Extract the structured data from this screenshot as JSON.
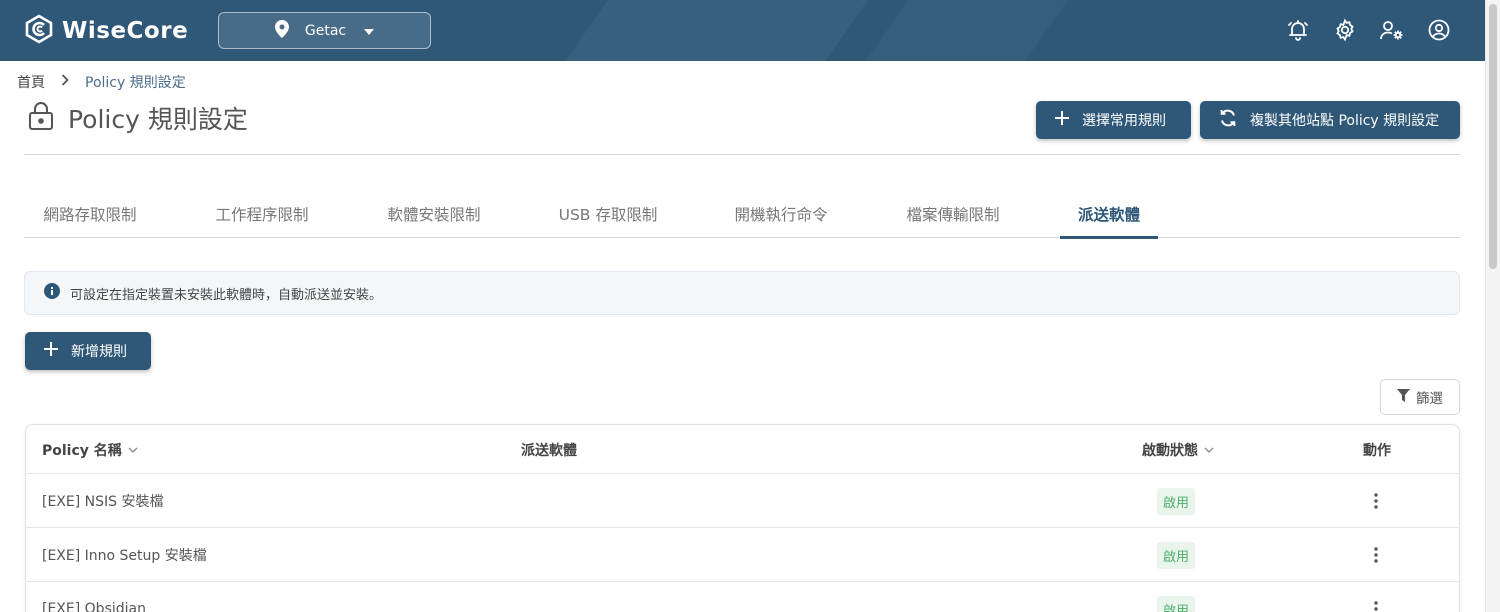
{
  "app": {
    "name": "WiseCore"
  },
  "site_selector": {
    "value": "Getac"
  },
  "breadcrumb": {
    "home": "首頁",
    "current": "Policy 規則設定"
  },
  "page": {
    "title": "Policy 規則設定"
  },
  "actions": {
    "choose_common": "選擇常用規則",
    "copy_other_site": "複製其他站點 Policy 規則設定",
    "add_rule": "新增規則",
    "filter": "篩選"
  },
  "tabs": [
    {
      "label": "網路存取限制"
    },
    {
      "label": "工作程序限制"
    },
    {
      "label": "軟體安裝限制"
    },
    {
      "label": "USB 存取限制"
    },
    {
      "label": "開機執行命令"
    },
    {
      "label": "檔案傳輸限制"
    },
    {
      "label": "派送軟體",
      "active": true
    }
  ],
  "info": {
    "text": "可設定在指定裝置未安裝此軟體時，自動派送並安裝。"
  },
  "table": {
    "columns": [
      "Policy 名稱",
      "派送軟體",
      "啟動狀態",
      "動作"
    ],
    "rows": [
      {
        "name": "[EXE] NSIS 安裝檔",
        "software": "",
        "status": "啟用"
      },
      {
        "name": "[EXE] Inno Setup 安裝檔",
        "software": "",
        "status": "啟用"
      },
      {
        "name": "[EXE] Obsidian",
        "software": "",
        "status": "啟用"
      }
    ]
  },
  "colors": {
    "primary": "#2f5778",
    "status_enabled": "#4caf6b",
    "status_bg": "#e9f5ec"
  },
  "icons": {
    "topbar": [
      "bell-icon",
      "gear-icon",
      "user-settings-icon",
      "account-icon"
    ],
    "title": "lock-icon",
    "site": "location-pin-icon"
  }
}
